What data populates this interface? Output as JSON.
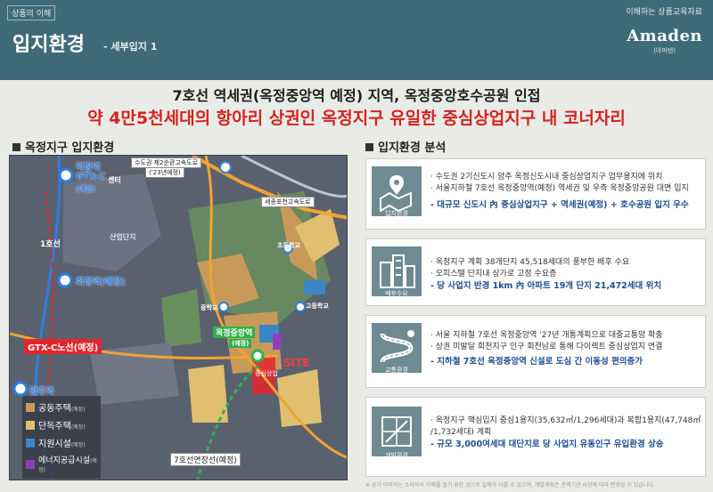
{
  "header": {
    "tag": "상품의 이해",
    "right_note": "이해하는 상품교육자료",
    "title": "입지환경",
    "subtitle": "- 세부입지 1",
    "logo_word": "Amaden",
    "logo_ko": "(아마덴)"
  },
  "headline": {
    "line1": "7호선 역세권(옥정중앙역 예정) 지역, 옥정중앙호수공원 인접",
    "line2": "약 4만5천세대의 항아리 상권인 옥정지구 유일한 중심상업지구 내  코너자리"
  },
  "left_section": {
    "title": "옥정지구 입지환경",
    "map": {
      "station_deokjeong": "덕정역",
      "gtx_c": "GTX-C",
      "gtx_c_plan": "(예정)",
      "center": "센터",
      "line1": "1호선",
      "hoejeong": "회정역(예정)",
      "gtx_line": "GTX-C노선(예정)",
      "yangju": "양주역",
      "highway": "수도권 제2순환고속도로",
      "highway_year": "('23년예정)",
      "sejong_highway": "세종포천고속도로",
      "line7_ext": "7호선연장선(예정)",
      "okjeong_station": "옥정중앙역",
      "okjeong_plan": "(예정)",
      "site": "SITE",
      "central_commercial": "중심상업",
      "highschool": "고등학교",
      "industrial": "산업단지",
      "school1": "초등학교",
      "school2": "중학교"
    },
    "legend": [
      {
        "label": "공동주택",
        "tag": "(예정)",
        "color": "#c89a5a"
      },
      {
        "label": "단독주택",
        "tag": "(예정)",
        "color": "#e0c070"
      },
      {
        "label": "지원시설",
        "tag": "(예정)",
        "color": "#3c86c8"
      },
      {
        "label": "에너지공급시설",
        "tag": "(예정)",
        "color": "#8b3fb8"
      }
    ]
  },
  "right_section": {
    "title": "입지환경 분석",
    "panels": [
      {
        "caption": "입지환경",
        "lines": [
          "· 수도권 2기신도시 양주 옥정신도시내 중심상업지구 업무용지에 위치",
          "· 서울지하철 7호선 옥정중앙역(예정) 역세권 및 우측 옥정중앙공원 대면 입지"
        ],
        "strong": "- 대규모 신도시 內 중심상업지구 + 역세권(예정) + 호수공원 입지 우수"
      },
      {
        "caption": "배후수요",
        "lines": [
          "· 옥정지구 계획 38개단지 45,518세대의 풍부한 배후 수요",
          "· 오피스텔 단지내 상가로 고정 수요층"
        ],
        "strong": "- 당 사업지 반경 1km 內 아파트 19개 단지 21,472세대 위치"
      },
      {
        "caption": "교통환경",
        "lines": [
          "· 서울 지하철 7호선 옥정중앙역 '27년 개통계획으로 대중교통망 확충",
          "· 상권 미발달 회천지구 인구 회천남로 통해 다이렉트 중심상업지 연결"
        ],
        "strong": "- 지하철 7호선 옥정중앙역 신설로 도심 간 이동성 편의증가"
      },
      {
        "caption": "개발환경",
        "lines": [
          "· 옥정지구 핵심입지 중심1용지(35,632㎡/1,296세대)과 복합1용지(47,748㎡",
          "  /1,732세대) 계획"
        ],
        "strong": "- 규모 3,000여세대 대단지로 당 사업지 유동인구 유입환경 상승"
      }
    ]
  },
  "footnote": "※ 상기 이미지는 소비자의 이해를 돕기 위한 것으로 실제와 다를 수 있으며, 개발계획은 관계기관 사정에 따라 변경될 수 있습니다."
}
